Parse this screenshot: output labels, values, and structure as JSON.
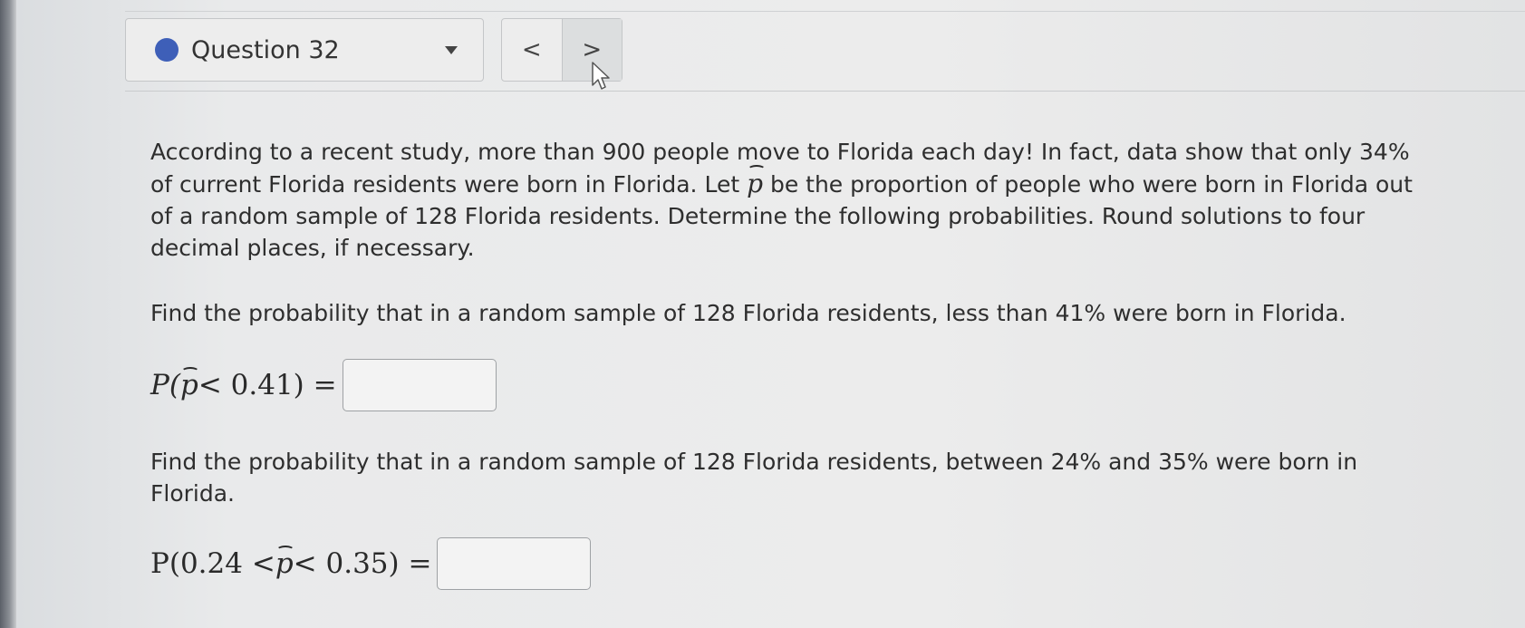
{
  "header": {
    "question_label": "Question 32",
    "status_color": "#3e5fb8",
    "prev_label": "<",
    "next_label": ">"
  },
  "problem": {
    "intro_1": "According to a recent study, more than 900 people move to Florida each day! In fact, data show that only 34% of current Florida residents were born in Florida. Let ",
    "intro_2": " be the proportion of people who were born in Florida out of a random sample of 128 Florida residents. Determine the following probabilities. Round solutions to four decimal places, if necessary.",
    "phat_symbol": "p",
    "q1_text": "Find the probability that in a random sample of 128 Florida residents, less than 41% were born in Florida.",
    "q1_math_prefix": "P(",
    "q1_math_suffix": " < 0.41) =",
    "q1_answer": "",
    "q2_text": "Find the probability that in a random sample of 128 Florida residents, between 24% and 35% were born in Florida.",
    "q2_math_prefix": "P(0.24 < ",
    "q2_math_suffix": " < 0.35) =",
    "q2_answer": ""
  }
}
